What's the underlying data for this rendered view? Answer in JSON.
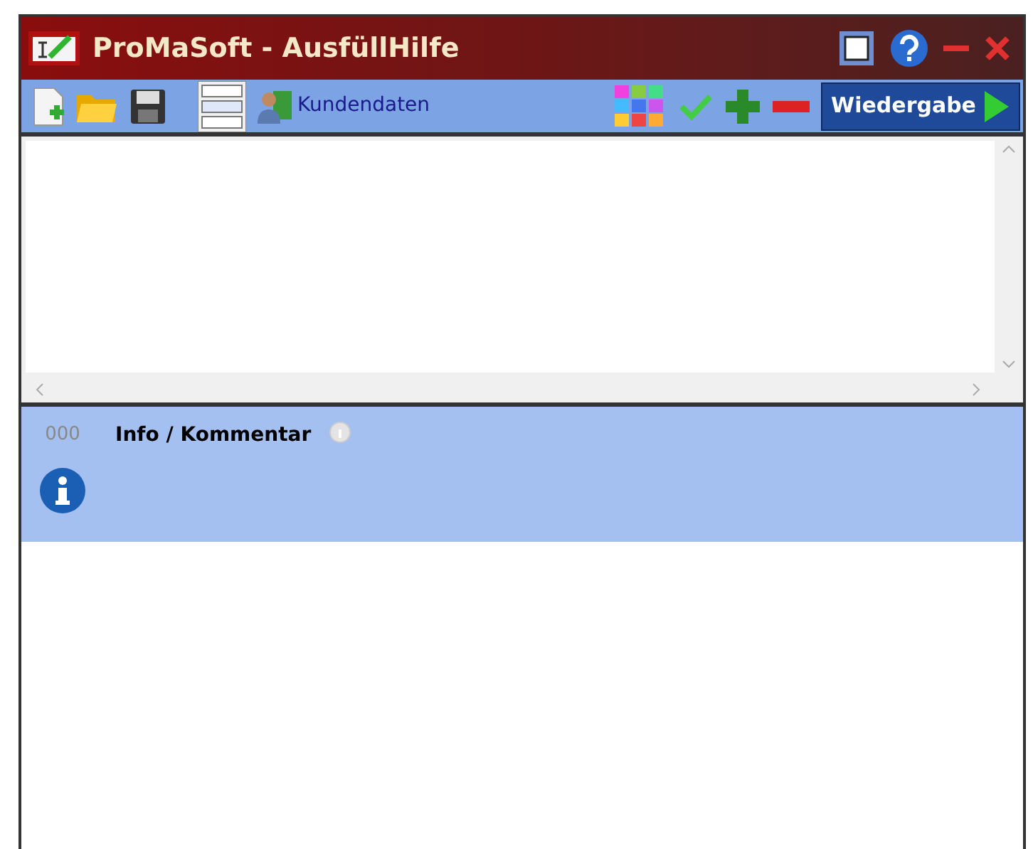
{
  "window": {
    "title": "ProMaSoft - AusfüllHilfe"
  },
  "toolbar": {
    "customer_link": "Kundendaten",
    "play_button": "Wiedergabe"
  },
  "info": {
    "number": "000",
    "title": "Info / Kommentar"
  }
}
